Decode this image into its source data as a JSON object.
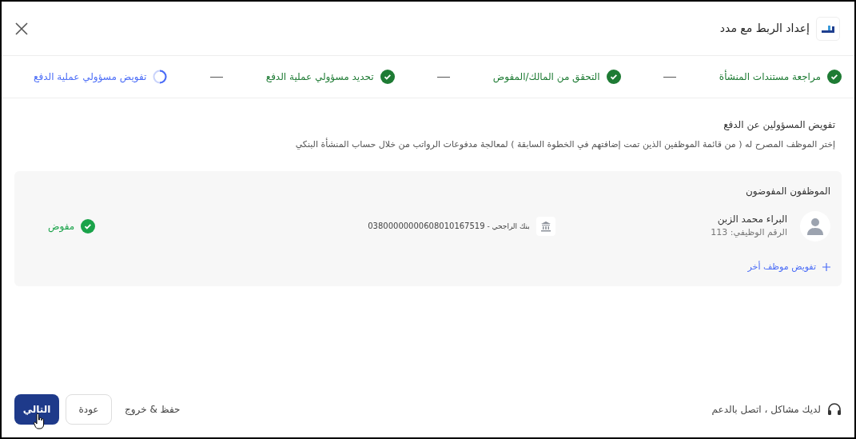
{
  "header": {
    "title": "إعداد الربط مع مدد"
  },
  "steps": [
    {
      "label": "مراجعة مستندات المنشأة",
      "kind": "done"
    },
    {
      "label": "التحقق من المالك/المفوض",
      "kind": "done"
    },
    {
      "label": "تحديد مسؤولي عملية الدفع",
      "kind": "done"
    },
    {
      "label": "تفويض مسؤولي عملية الدفع",
      "kind": "current"
    }
  ],
  "section": {
    "title": "تفويض المسؤولين عن الدفع",
    "description": "إختر الموظف المصرح له ( من قائمة الموظفين الذين تمت إضافتهم في الخطوة السابقة ) لمعالجة مدفوعات الرواتب من خلال حساب المنشأة البنكي"
  },
  "panel": {
    "title": "الموظفون المفوضون",
    "employees": [
      {
        "name": "البراء محمد الزبن",
        "employee_id": "الرقم الوظيفي: 113",
        "bank": "بنك الراجحي - ",
        "account": "03800000000608010167519",
        "status": "مفوض",
        "authorized": true
      }
    ],
    "add_link": "تفويض موظف أخر"
  },
  "footer": {
    "support": "لديك مشاكل ، اتصل بالدعم",
    "save_exit": "حفظ & خروج",
    "back": "عودة",
    "next": "التالي"
  }
}
